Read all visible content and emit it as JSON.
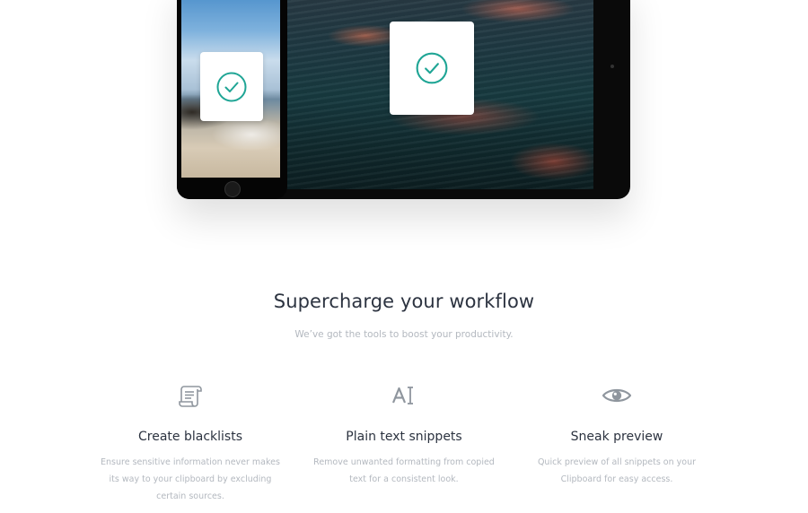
{
  "hero": {
    "phone_card_icon": "check-circle-icon",
    "tablet_card_icon": "check-circle-icon",
    "accent_color": "#1fa595"
  },
  "section": {
    "title": "Supercharge your workflow",
    "subtitle": "We’ve got the tools to boost your productivity."
  },
  "features": [
    {
      "icon": "scroll-list-icon",
      "title": "Create blacklists",
      "description": "Ensure sensitive information never makes its way to your clipboard by excluding certain sources."
    },
    {
      "icon": "text-cursor-icon",
      "title": "Plain text snippets",
      "description": "Remove unwanted formatting from copied text for a consistent look."
    },
    {
      "icon": "eye-icon",
      "title": "Sneak preview",
      "description": "Quick preview of all snippets on your Clipboard for easy access."
    }
  ],
  "colors": {
    "heading": "#2c3340",
    "muted_text": "#b3b8bf",
    "icon_gray": "#8f969e"
  }
}
